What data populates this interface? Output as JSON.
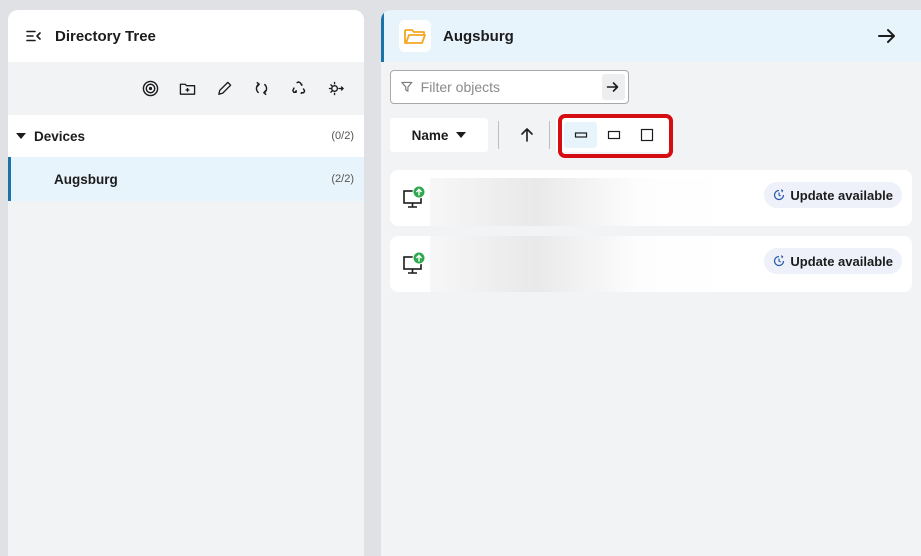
{
  "left_panel": {
    "title": "Directory Tree",
    "toolbar_icons": [
      "target-icon",
      "new-folder-icon",
      "edit-icon",
      "sync-icon",
      "recycle-icon",
      "move-icon"
    ],
    "tree": {
      "root": {
        "label": "Devices",
        "count": "(0/2)"
      },
      "children": [
        {
          "label": "Augsburg",
          "count": "(2/2)"
        }
      ]
    }
  },
  "right_panel": {
    "title": "Augsburg",
    "filter": {
      "placeholder": "Filter objects",
      "value": ""
    },
    "sort": {
      "label": "Name"
    },
    "view_modes": [
      "compact-view",
      "medium-view",
      "large-view"
    ],
    "items": [
      {
        "status": "Update available"
      },
      {
        "status": "Update available"
      }
    ]
  },
  "colors": {
    "accent": "#1a73a8",
    "selected_bg": "#e8f4fb",
    "highlight": "#d40d12",
    "folder": "#f5a623",
    "device_update": "#2fa84f"
  }
}
